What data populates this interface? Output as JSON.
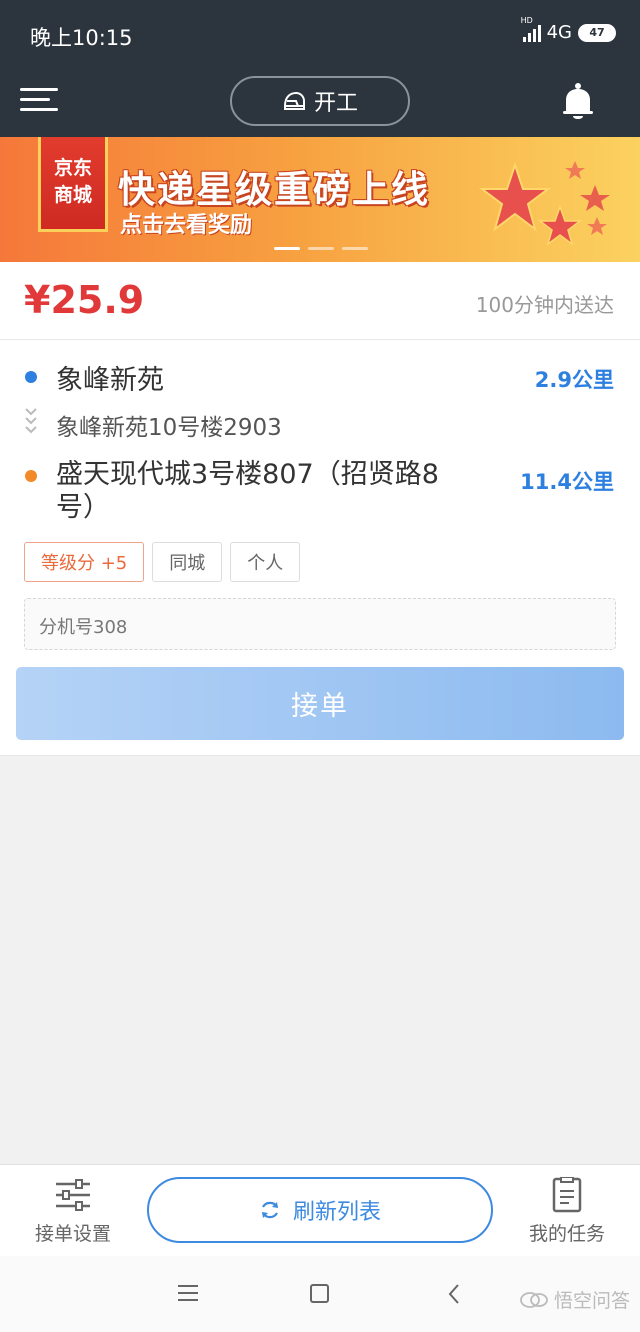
{
  "status_bar": {
    "time": "晚上10:15",
    "network_badge": "HD",
    "network": "4G",
    "battery": "47"
  },
  "header": {
    "start_label": "开工",
    "icons": [
      "menu-icon",
      "helmet-icon",
      "bell-icon"
    ]
  },
  "banner": {
    "tag_line1": "京东",
    "tag_line2": "商城",
    "title": "快递星级重磅上线",
    "subtitle": "点击去看奖励",
    "slides": 3,
    "active_slide": 1
  },
  "order": {
    "price": "¥25.9",
    "eta": "100分钟内送达",
    "pickup": {
      "name": "象峰新苑",
      "distance": "2.9公里",
      "address": "象峰新苑10号楼2903"
    },
    "dropoff": {
      "name": "盛天现代城3号楼807（招贤路8号）",
      "distance": "11.4公里"
    },
    "tags": [
      "等级分 +5",
      "同城",
      "个人"
    ],
    "note": "分机号308",
    "accept_label": "接单"
  },
  "toolbar": {
    "settings_label": "接单设置",
    "refresh_label": "刷新列表",
    "tasks_label": "我的任务"
  },
  "watermark": "悟空问答",
  "colors": {
    "header_bg": "#2c343e",
    "price": "#e1393a",
    "accent_blue": "#2d7fe0",
    "accent_orange": "#f28a27"
  }
}
